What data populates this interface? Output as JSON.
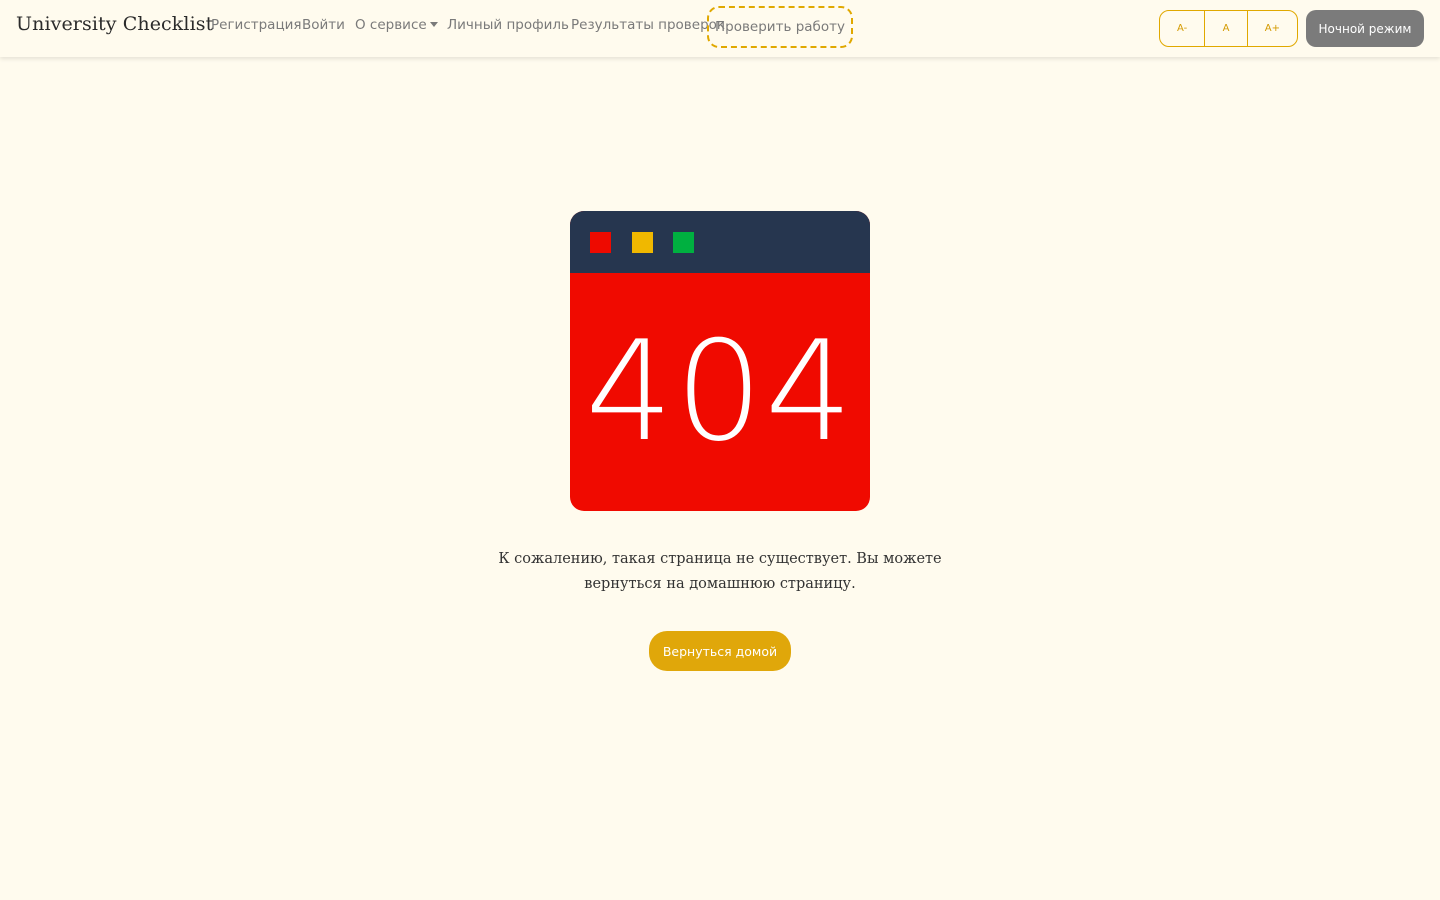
{
  "navbar": {
    "brand": "University Checklist",
    "links": {
      "register": "Регистрация",
      "login": "Войти",
      "about": "О сервисе",
      "profile": "Личный профиль",
      "results": "Результаты проверок"
    },
    "check_work": "Проверить работу",
    "font_size": {
      "decrease": "A-",
      "normal": "A",
      "increase": "A+"
    },
    "night_mode": "Ночной режим"
  },
  "error": {
    "code": "404",
    "window_dots": [
      "red",
      "yellow",
      "green"
    ],
    "message": "К сожалению, такая страница не существует. Вы можете вернуться на домашнюю страницу.",
    "home_button": "Вернуться домой"
  },
  "colors": {
    "background": "#fffbee",
    "accent": "#e0a800",
    "error_red": "#f00a00",
    "window_bar": "#26364f",
    "dot_red": "#ee0a00",
    "dot_yellow": "#f0b800",
    "dot_green": "#00b040",
    "night_button": "#7b7b7b"
  }
}
